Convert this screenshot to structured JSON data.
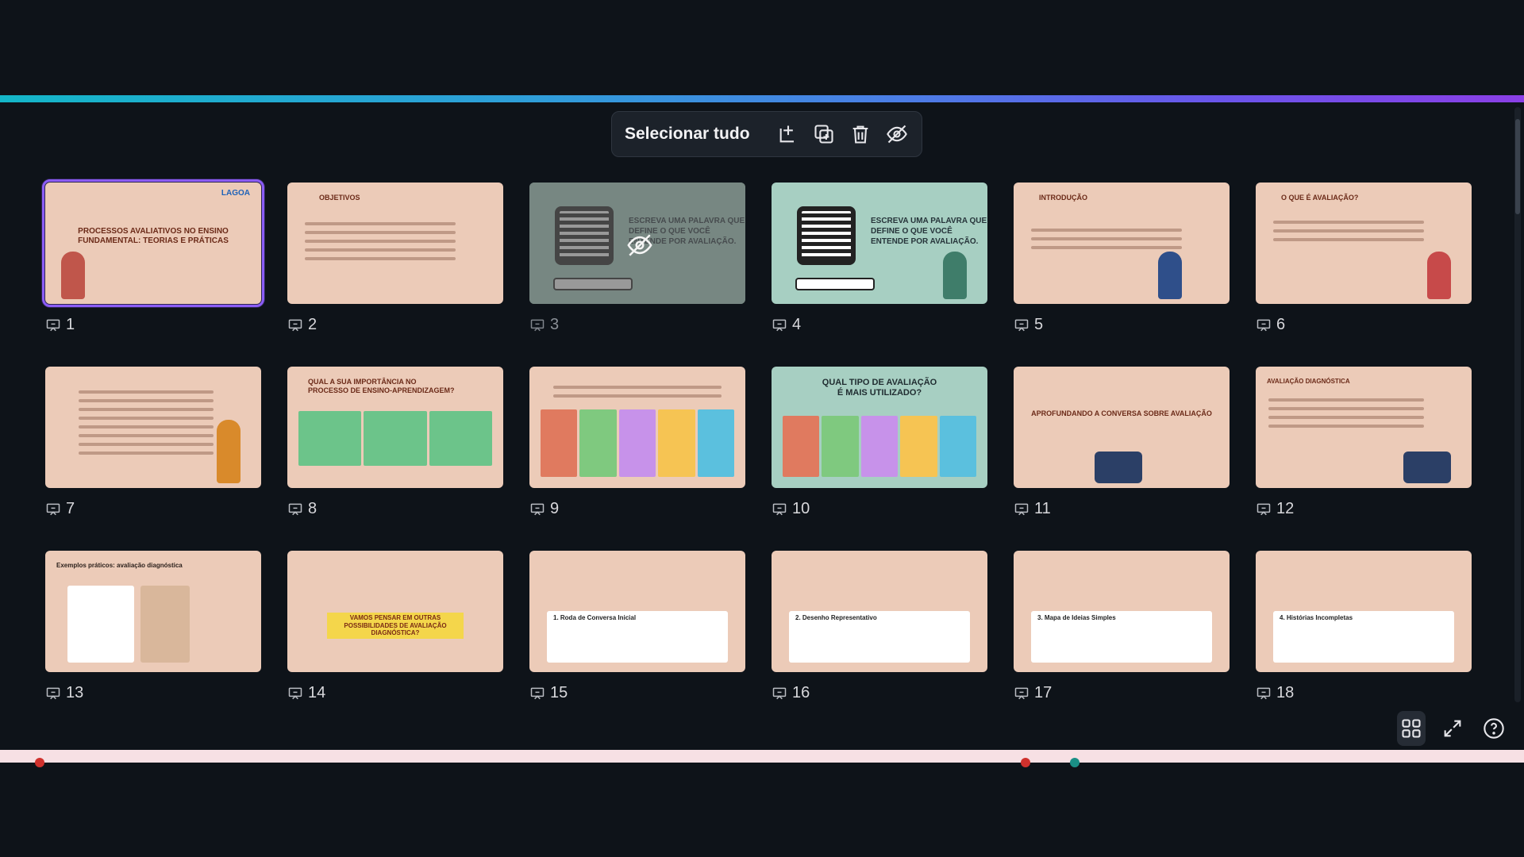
{
  "toolbar": {
    "select_all_label": "Selecionar tudo",
    "buttons": [
      {
        "name": "add-slide-button",
        "icon": "add-page-icon"
      },
      {
        "name": "duplicate-button",
        "icon": "duplicate-icon"
      },
      {
        "name": "delete-button",
        "icon": "trash-icon"
      },
      {
        "name": "hide-button",
        "icon": "eye-off-icon"
      }
    ]
  },
  "colors": {
    "background": "#0e1319",
    "accent_purple": "#8b5cf6",
    "slide_peach": "#eccbb8",
    "slide_green": "#a7cfc2"
  },
  "slides": [
    {
      "number": "1",
      "title": "PROCESSOS AVALIATIVOS NO ENSINO FUNDAMENTAL: TEORIAS E PRÁTICAS",
      "logo": "LAGOA",
      "selected": true
    },
    {
      "number": "2",
      "title": "OBJETIVOS"
    },
    {
      "number": "3",
      "text": "ESCREVA UMA PALAVRA QUE DEFINE O QUE VOCÊ ENTENDE POR AVALIAÇÃO.",
      "hidden": true
    },
    {
      "number": "4",
      "text": "ESCREVA UMA PALAVRA QUE DEFINE O QUE VOCÊ ENTENDE POR AVALIAÇÃO."
    },
    {
      "number": "5",
      "title": "INTRODUÇÃO"
    },
    {
      "number": "6",
      "title": "O QUE É AVALIAÇÃO?"
    },
    {
      "number": "7",
      "title": ""
    },
    {
      "number": "8",
      "title": "QUAL A SUA IMPORTÂNCIA NO PROCESSO DE ENSINO-APRENDIZAGEM?"
    },
    {
      "number": "9",
      "title": ""
    },
    {
      "number": "10",
      "title": "QUAL TIPO DE AVALIAÇÃO É MAIS UTILIZADO?"
    },
    {
      "number": "11",
      "title": "APROFUNDANDO A CONVERSA SOBRE AVALIAÇÃO"
    },
    {
      "number": "12",
      "title": "AVALIAÇÃO DIAGNÓSTICA"
    },
    {
      "number": "13",
      "title": "Exemplos práticos: avaliação diagnóstica"
    },
    {
      "number": "14",
      "title": "VAMOS PENSAR EM OUTRAS POSSIBILIDADES DE AVALIAÇÃO DIAGNÓSTICA?"
    },
    {
      "number": "15",
      "title": "1. Roda de Conversa Inicial"
    },
    {
      "number": "16",
      "title": "2. Desenho Representativo"
    },
    {
      "number": "17",
      "title": "3. Mapa de Ideias Simples"
    },
    {
      "number": "18",
      "title": "4. Histórias Incompletas"
    }
  ],
  "bottom_tools": [
    {
      "name": "grid-view-button",
      "icon": "grid-icon",
      "active": true
    },
    {
      "name": "fullscreen-button",
      "icon": "expand-icon"
    },
    {
      "name": "help-button",
      "icon": "help-icon"
    }
  ]
}
